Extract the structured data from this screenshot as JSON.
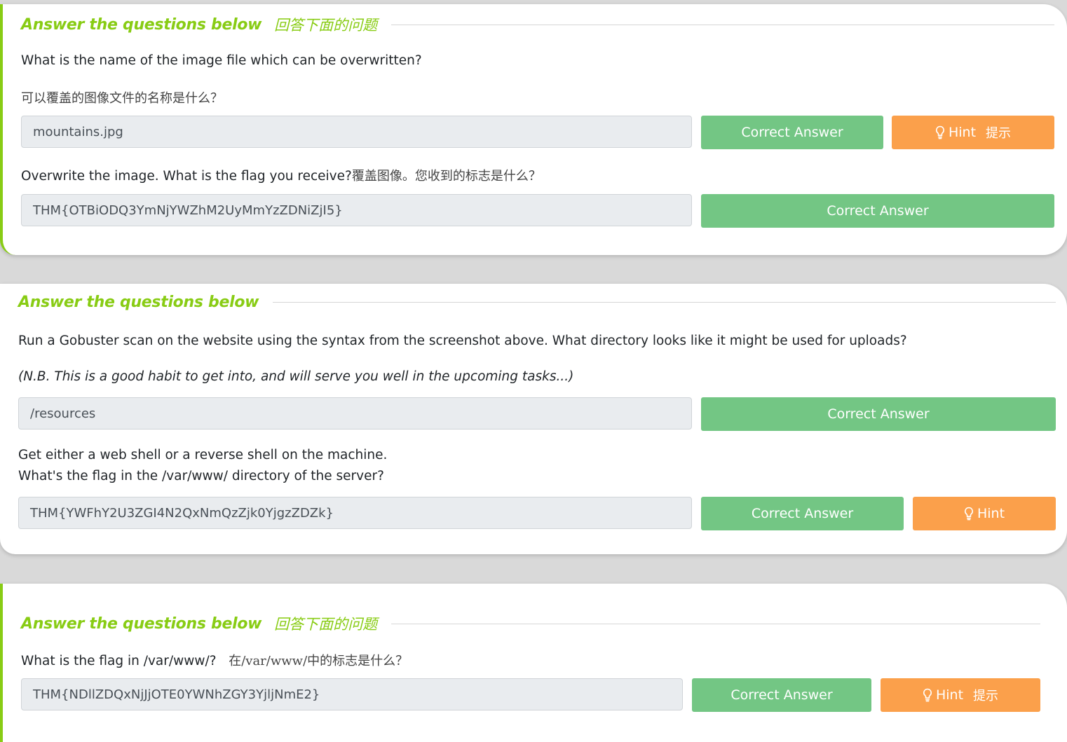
{
  "section1": {
    "title": "Answer the questions below",
    "title_cn": "回答下面的问题",
    "q1_en": "What is the name of the image file which can be overwritten?",
    "q1_cn": "可以覆盖的图像文件的名称是什么？",
    "a1": "mountains.jpg",
    "q2_en": "Overwrite the image. What is the flag you receive?",
    "q2_cn": "覆盖图像。您收到的标志是什么？",
    "a2": "THM{OTBiODQ3YmNjYWZhM2UyMmYzZDNiZjI5}"
  },
  "section2": {
    "title": "Answer the questions below",
    "q1": "Run a Gobuster scan on the website using the syntax from the screenshot above. What directory looks like it might be used for uploads?",
    "q1_note": "(N.B. This is a good habit to get into, and will serve you well in the upcoming tasks...)",
    "a1": "/resources",
    "q2_line1": "Get either a web shell or a reverse shell on the machine.",
    "q2_line2": "What's the flag in the /var/www/ directory of the server?",
    "a2": "THM{YWFhY2U3ZGI4N2QxNmQzZjk0YjgzZDZk}"
  },
  "section3": {
    "title": "Answer the questions below",
    "title_cn": "回答下面的问题",
    "q1_en": "What is the flag in /var/www/?",
    "q1_cn": "在/var/www/中的标志是什么？",
    "a1": "THM{NDllZDQxNjJjOTE0YWNhZGY3YjljNmE2}"
  },
  "buttons": {
    "correct": "Correct Answer",
    "hint": "Hint",
    "hint_cn": "提示"
  },
  "colors": {
    "accent": "#88cc14",
    "correct": "#73c684",
    "hint": "#fba04b"
  }
}
